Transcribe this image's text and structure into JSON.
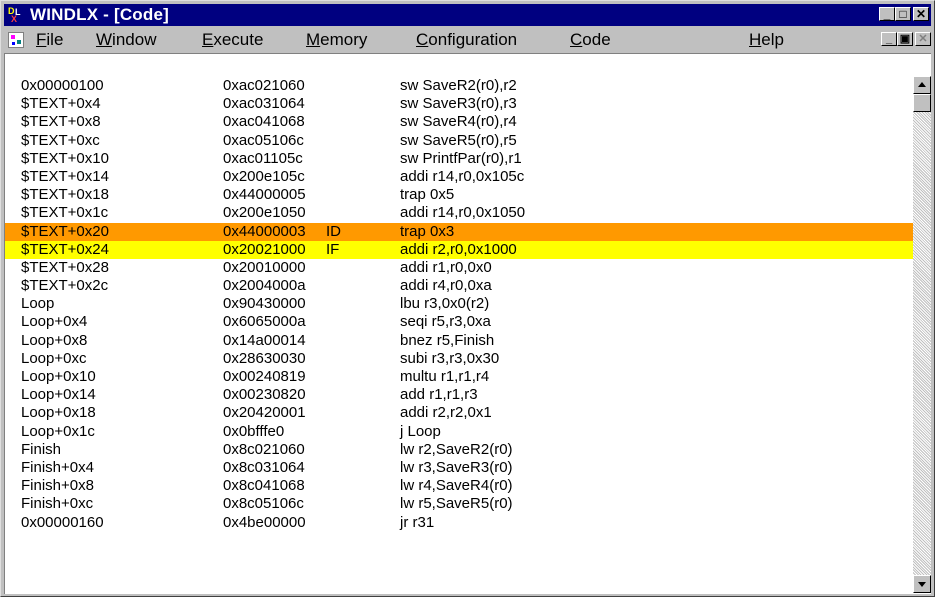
{
  "window": {
    "title": "WINDLX - [Code]",
    "caption_buttons": {
      "minimize": "_",
      "maximize": "□",
      "close": "✕"
    }
  },
  "menu": {
    "items": [
      {
        "label": "File"
      },
      {
        "label": "Window"
      },
      {
        "label": "Execute"
      },
      {
        "label": "Memory"
      },
      {
        "label": "Configuration"
      },
      {
        "label": "Code"
      },
      {
        "label": "Help"
      }
    ],
    "mdi_buttons": {
      "minimize": "_",
      "restore": "▣",
      "close": "✕"
    }
  },
  "code": {
    "highlight_colors": {
      "ID": "#ff9900",
      "IF": "#ffff00"
    },
    "rows": [
      {
        "address": "0x00000100",
        "instr": "0xac021060",
        "stage": "",
        "asm": "sw SaveR2(r0),r2"
      },
      {
        "address": "$TEXT+0x4",
        "instr": "0xac031064",
        "stage": "",
        "asm": "sw SaveR3(r0),r3"
      },
      {
        "address": "$TEXT+0x8",
        "instr": "0xac041068",
        "stage": "",
        "asm": "sw SaveR4(r0),r4"
      },
      {
        "address": "$TEXT+0xc",
        "instr": "0xac05106c",
        "stage": "",
        "asm": "sw SaveR5(r0),r5"
      },
      {
        "address": "$TEXT+0x10",
        "instr": "0xac01105c",
        "stage": "",
        "asm": "sw PrintfPar(r0),r1"
      },
      {
        "address": "$TEXT+0x14",
        "instr": "0x200e105c",
        "stage": "",
        "asm": "addi r14,r0,0x105c"
      },
      {
        "address": "$TEXT+0x18",
        "instr": "0x44000005",
        "stage": "",
        "asm": "trap 0x5"
      },
      {
        "address": "$TEXT+0x1c",
        "instr": "0x200e1050",
        "stage": "",
        "asm": "addi r14,r0,0x1050"
      },
      {
        "address": "$TEXT+0x20",
        "instr": "0x44000003",
        "stage": "ID",
        "asm": "trap 0x3"
      },
      {
        "address": "$TEXT+0x24",
        "instr": "0x20021000",
        "stage": "IF",
        "asm": "addi r2,r0,0x1000"
      },
      {
        "address": "$TEXT+0x28",
        "instr": "0x20010000",
        "stage": "",
        "asm": "addi r1,r0,0x0"
      },
      {
        "address": "$TEXT+0x2c",
        "instr": "0x2004000a",
        "stage": "",
        "asm": "addi r4,r0,0xa"
      },
      {
        "address": "Loop",
        "instr": "0x90430000",
        "stage": "",
        "asm": "lbu r3,0x0(r2)"
      },
      {
        "address": "Loop+0x4",
        "instr": "0x6065000a",
        "stage": "",
        "asm": "seqi r5,r3,0xa"
      },
      {
        "address": "Loop+0x8",
        "instr": "0x14a00014",
        "stage": "",
        "asm": "bnez r5,Finish"
      },
      {
        "address": "Loop+0xc",
        "instr": "0x28630030",
        "stage": "",
        "asm": "subi r3,r3,0x30"
      },
      {
        "address": "Loop+0x10",
        "instr": "0x00240819",
        "stage": "",
        "asm": "multu r1,r1,r4"
      },
      {
        "address": "Loop+0x14",
        "instr": "0x00230820",
        "stage": "",
        "asm": "add r1,r1,r3"
      },
      {
        "address": "Loop+0x18",
        "instr": "0x20420001",
        "stage": "",
        "asm": "addi r2,r2,0x1"
      },
      {
        "address": "Loop+0x1c",
        "instr": "0x0bfffe0",
        "stage": "",
        "asm": "j Loop"
      },
      {
        "address": "Finish",
        "instr": "0x8c021060",
        "stage": "",
        "asm": "lw r2,SaveR2(r0)"
      },
      {
        "address": "Finish+0x4",
        "instr": "0x8c031064",
        "stage": "",
        "asm": "lw r3,SaveR3(r0)"
      },
      {
        "address": "Finish+0x8",
        "instr": "0x8c041068",
        "stage": "",
        "asm": "lw r4,SaveR4(r0)"
      },
      {
        "address": "Finish+0xc",
        "instr": "0x8c05106c",
        "stage": "",
        "asm": "lw r5,SaveR5(r0)"
      },
      {
        "address": "0x00000160",
        "instr": "0x4be00000",
        "stage": "",
        "asm": "jr r31"
      }
    ]
  }
}
